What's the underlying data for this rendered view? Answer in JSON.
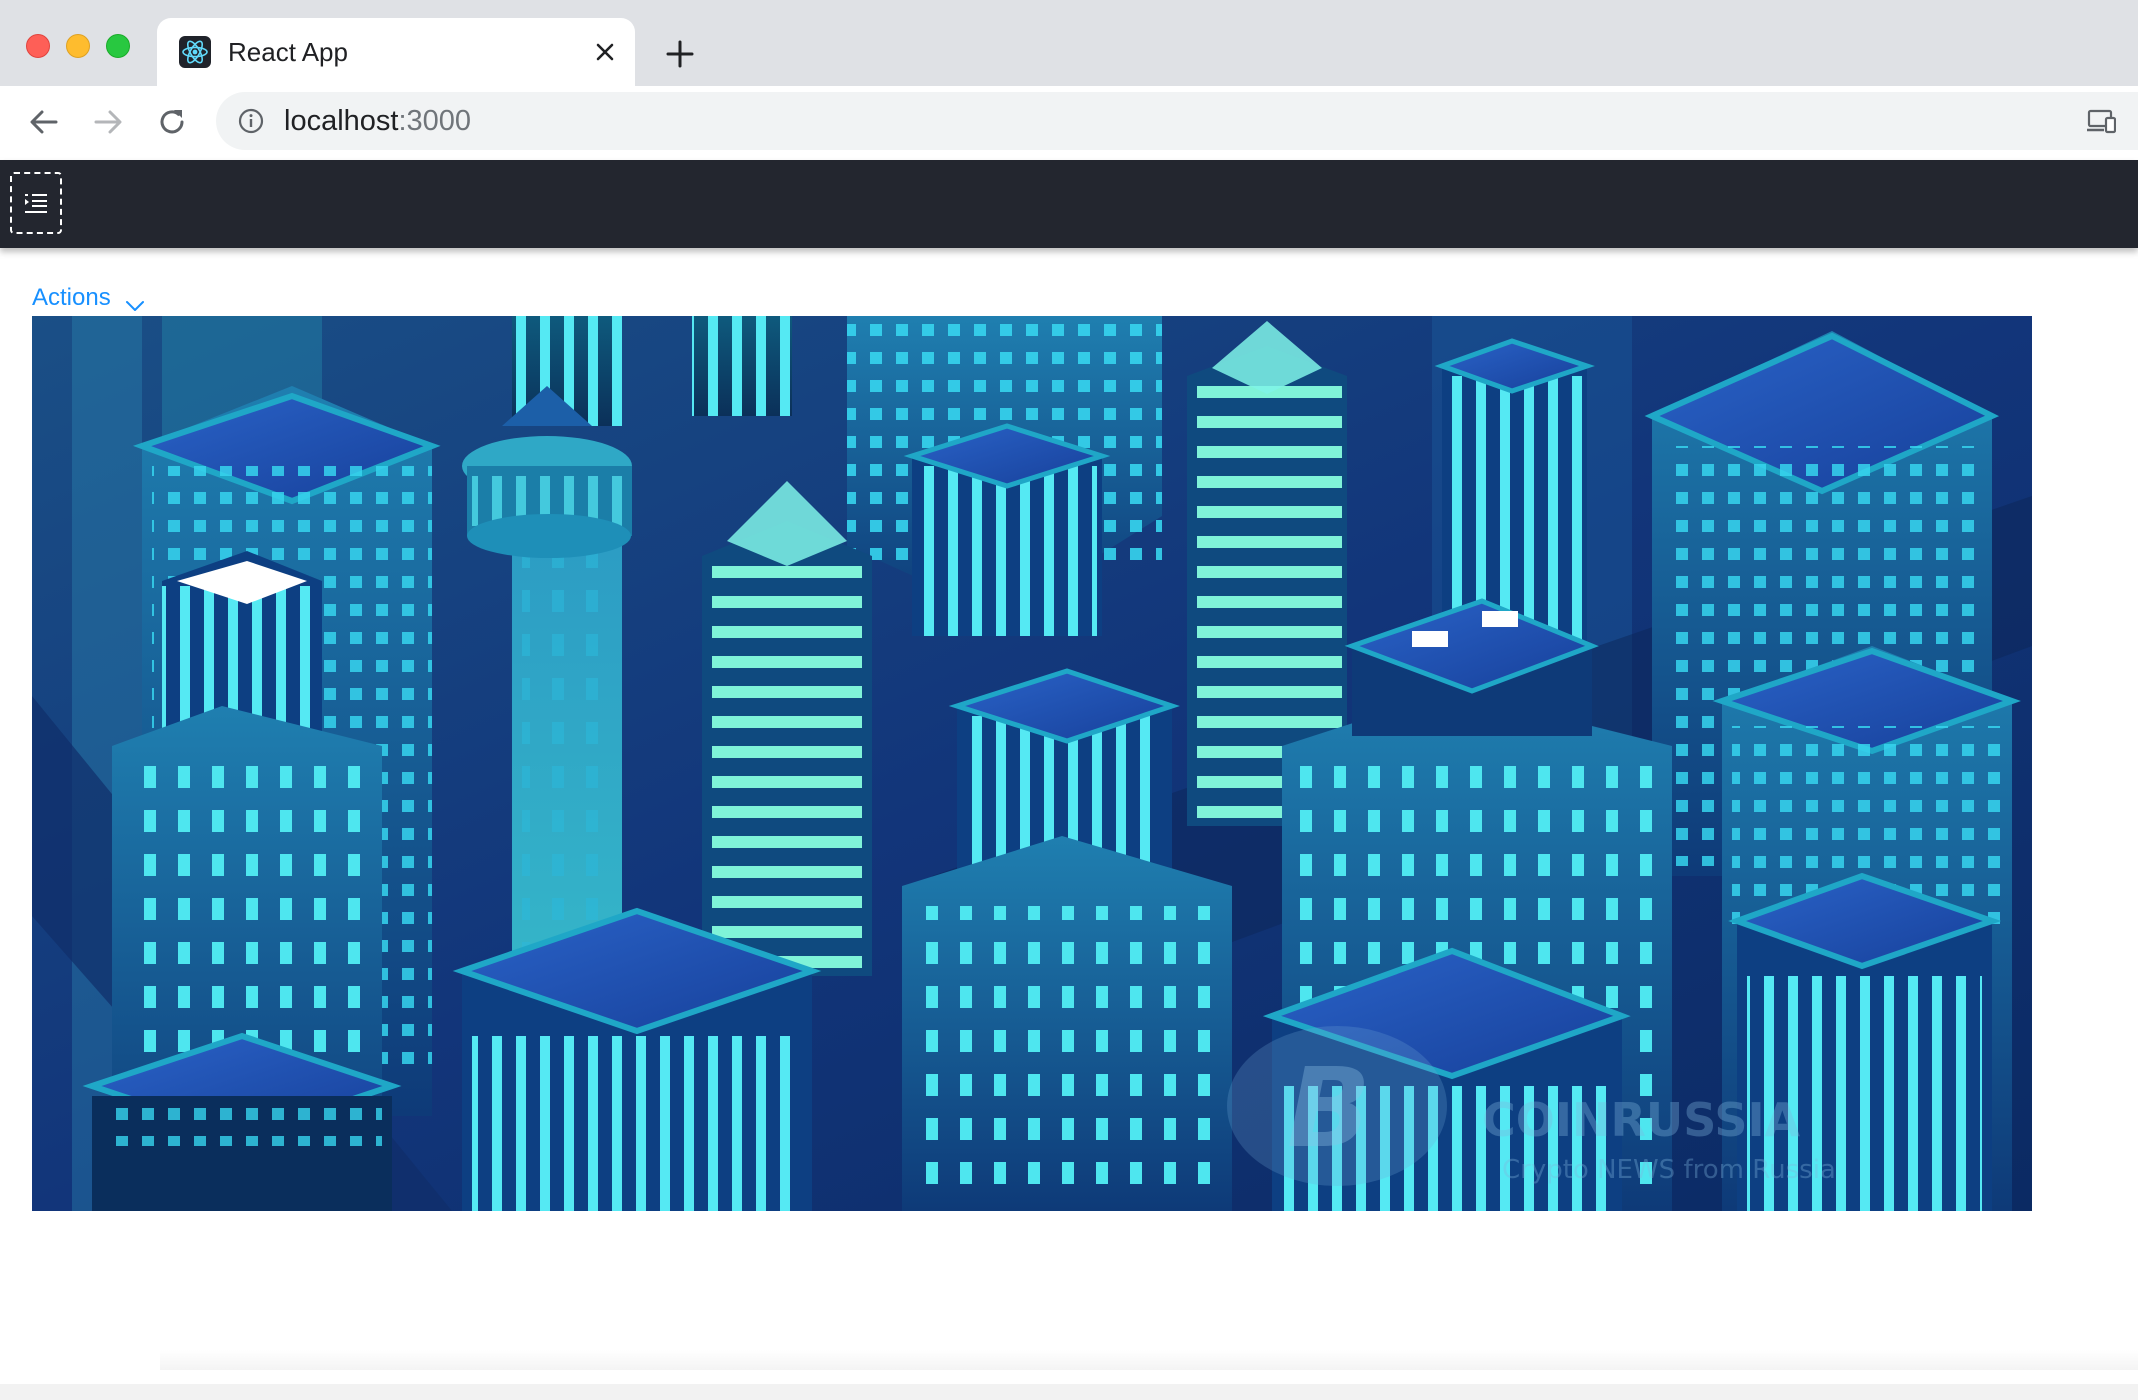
{
  "browser": {
    "tab": {
      "title": "React App",
      "favicon": "react-logo-icon",
      "close_icon": "close-icon"
    },
    "new_tab_icon": "plus-icon",
    "nav": {
      "back_icon": "arrow-left-icon",
      "forward_icon": "arrow-right-icon",
      "reload_icon": "reload-icon"
    },
    "address": {
      "host": "localhost",
      "port": ":3000",
      "security_icon": "info-icon",
      "device_icon": "cast-icon"
    }
  },
  "app": {
    "header": {
      "menu_toggle_icon": "indent-menu-icon",
      "background": "#23262f"
    },
    "actions": {
      "label": "Actions",
      "icon": "chevron-down-icon",
      "color": "#1890ff"
    },
    "hero_image": {
      "alt": "Isometric neon blue city skyline",
      "watermark_brand": "COINRUSSIA",
      "watermark_tagline": "Crypto NEWS from Russia"
    }
  }
}
